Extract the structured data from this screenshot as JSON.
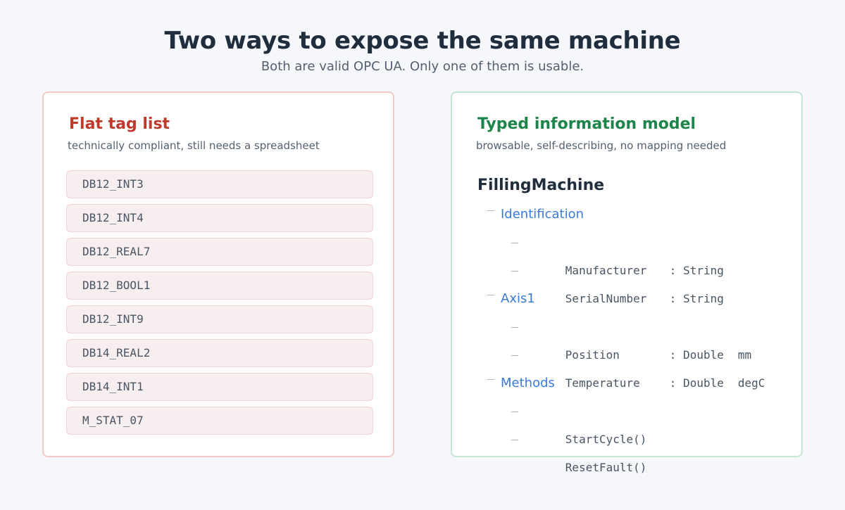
{
  "title": "Two ways to expose the same machine",
  "subtitle": "Both are valid OPC UA. Only one of them is usable.",
  "left": {
    "title": "Flat tag list",
    "subtitle": "technically compliant, still needs a spreadsheet",
    "tags": [
      "DB12_INT3",
      "DB12_INT4",
      "DB12_REAL7",
      "DB12_BOOL1",
      "DB12_INT9",
      "DB14_REAL2",
      "DB14_INT1",
      "M_STAT_07"
    ]
  },
  "right": {
    "title": "Typed information model",
    "subtitle": "browsable, self-describing, no mapping needed",
    "root": "FillingMachine",
    "groups": [
      {
        "name": "Identification",
        "items": [
          {
            "name": "Manufacturer",
            "type": ": String",
            "unit": ""
          },
          {
            "name": "SerialNumber",
            "type": ": String",
            "unit": ""
          }
        ]
      },
      {
        "name": "Axis1",
        "items": [
          {
            "name": "Position",
            "type": ": Double",
            "unit": "mm"
          },
          {
            "name": "Temperature",
            "type": ": Double",
            "unit": "degC"
          }
        ]
      },
      {
        "name": "Methods",
        "items": [
          {
            "name": "StartCycle()",
            "type": "",
            "unit": ""
          },
          {
            "name": "ResetFault()",
            "type": "",
            "unit": ""
          }
        ]
      }
    ]
  }
}
